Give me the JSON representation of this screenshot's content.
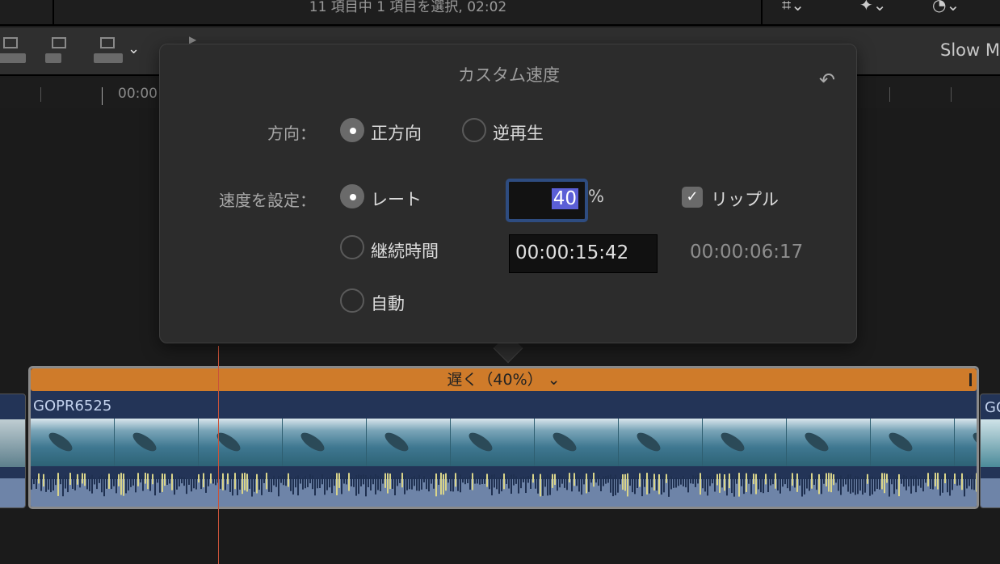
{
  "topbar": {
    "status": "11 項目中 1 項目を選択, 02:02"
  },
  "toolbar": {
    "slow_label": "Slow M"
  },
  "ruler": {
    "time": "00:00"
  },
  "popover": {
    "title": "カスタム速度",
    "direction_label": "方向：",
    "forward": "正方向",
    "reverse": "逆再生",
    "set_speed_label": "速度を設定：",
    "rate": "レート",
    "duration": "継続時間",
    "auto": "自動",
    "rate_value": "40",
    "percent": "%",
    "ripple": "リップル",
    "ripple_checked": true,
    "duration_value": "00:00:15:42",
    "original_duration": "00:00:06:17"
  },
  "clip": {
    "speed_label": "遅く（40%）",
    "name": "GOPR6525",
    "next_name": "GO",
    "speed_color": "#cf7b2a"
  }
}
